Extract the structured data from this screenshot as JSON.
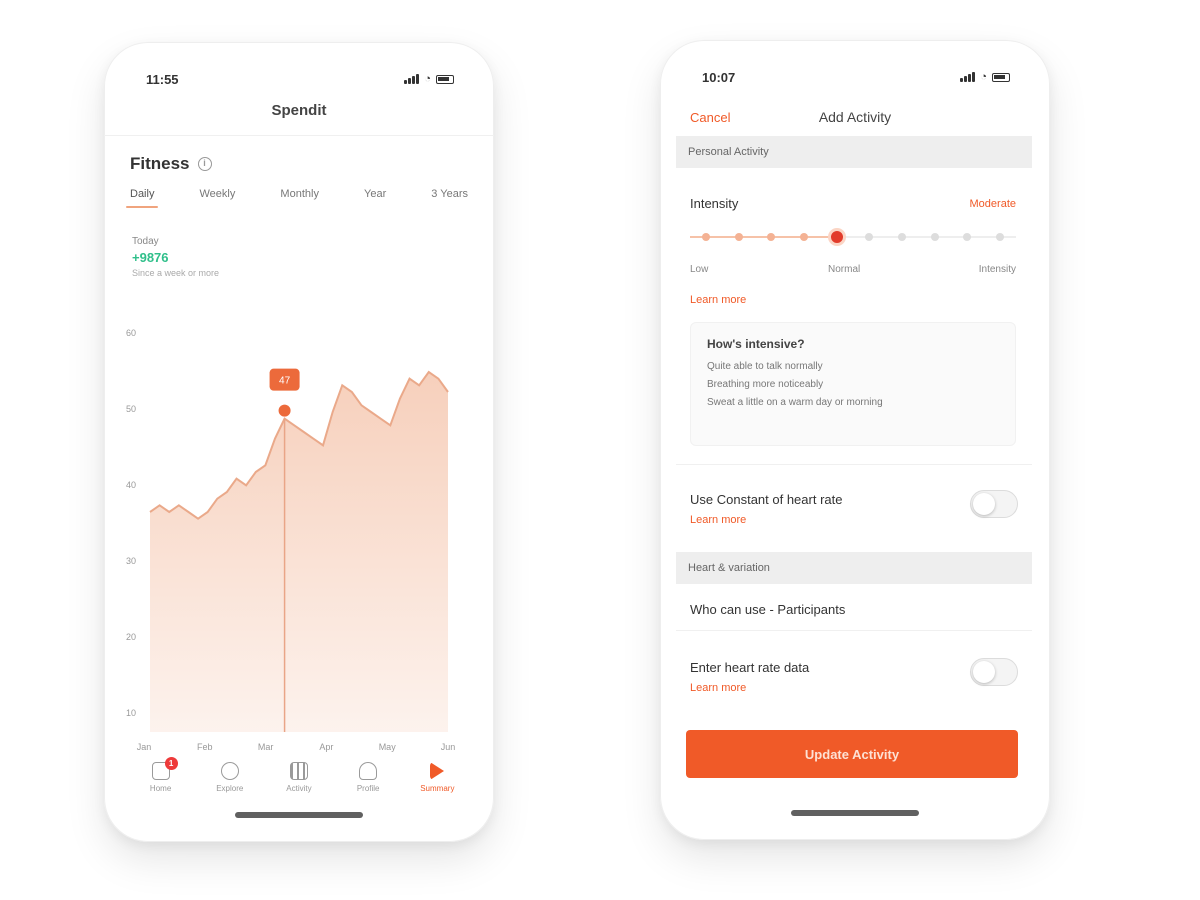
{
  "colors": {
    "accent": "#f05a28",
    "positive": "#2fbf8a",
    "chart_fill": "#f6cdb8",
    "chart_line": "#eaa98a",
    "marker": "#ec6a3b"
  },
  "left_phone": {
    "status": {
      "time": "11:55"
    },
    "nav": {
      "title": "Spendit"
    },
    "metric": {
      "title": "Fitness",
      "info_icon": "info-icon"
    },
    "ranges": [
      "Daily",
      "Weekly",
      "Monthly",
      "Year",
      "3 Years"
    ],
    "active_range": 0,
    "summary": {
      "label": "Today",
      "value": "+9876",
      "sub": "Since a week or more"
    },
    "tabbar": [
      {
        "label": "Home",
        "icon": "home-icon",
        "badge": "1"
      },
      {
        "label": "Explore",
        "icon": "explore-icon"
      },
      {
        "label": "Activity",
        "icon": "activity-icon"
      },
      {
        "label": "Profile",
        "icon": "profile-icon"
      },
      {
        "label": "Summary",
        "icon": "summary-icon",
        "active": true
      }
    ]
  },
  "chart_data": {
    "type": "area",
    "title": "",
    "xlabel": "",
    "ylabel": "",
    "x_tick_labels": [
      "Jan",
      "Feb",
      "Mar",
      "Apr",
      "May",
      "Jun"
    ],
    "y_tick_labels": [
      "60",
      "50",
      "40",
      "30",
      "20",
      "10"
    ],
    "ylim": [
      0,
      60
    ],
    "series": [
      {
        "values": [
          33,
          34,
          33,
          34,
          33,
          32,
          33,
          35,
          36,
          38,
          37,
          39,
          40,
          44,
          47,
          46,
          45,
          44,
          43,
          48,
          52,
          51,
          49,
          48,
          47,
          46,
          50,
          53,
          52,
          54,
          53,
          51
        ]
      }
    ],
    "highlight_index": 14,
    "highlight_label": "47",
    "grid": false
  },
  "right_phone": {
    "status": {
      "time": "10:07"
    },
    "nav": {
      "cancel_label": "Cancel",
      "title": "Add Activity"
    },
    "section1": {
      "title": "Personal Activity"
    },
    "intensity": {
      "label": "Intensity",
      "value": "Moderate",
      "ticks": 10,
      "selected": 4,
      "scale_labels": [
        "Low",
        "Normal",
        "Intensity"
      ],
      "learn_link": "Learn more"
    },
    "hint": {
      "title": "How's intensive?",
      "lines": [
        "Quite able to talk normally",
        "Breathing more noticeably",
        "Sweat a little on a warm day or morning"
      ]
    },
    "toggle1": {
      "label": "Use Constant of heart rate",
      "link": "Learn more"
    },
    "section2": {
      "title": "Heart & variation"
    },
    "row_text": "Who can use - Participants",
    "toggle2": {
      "label": "Enter heart rate data",
      "link": "Learn more"
    },
    "button": {
      "label": "Update Activity"
    }
  }
}
